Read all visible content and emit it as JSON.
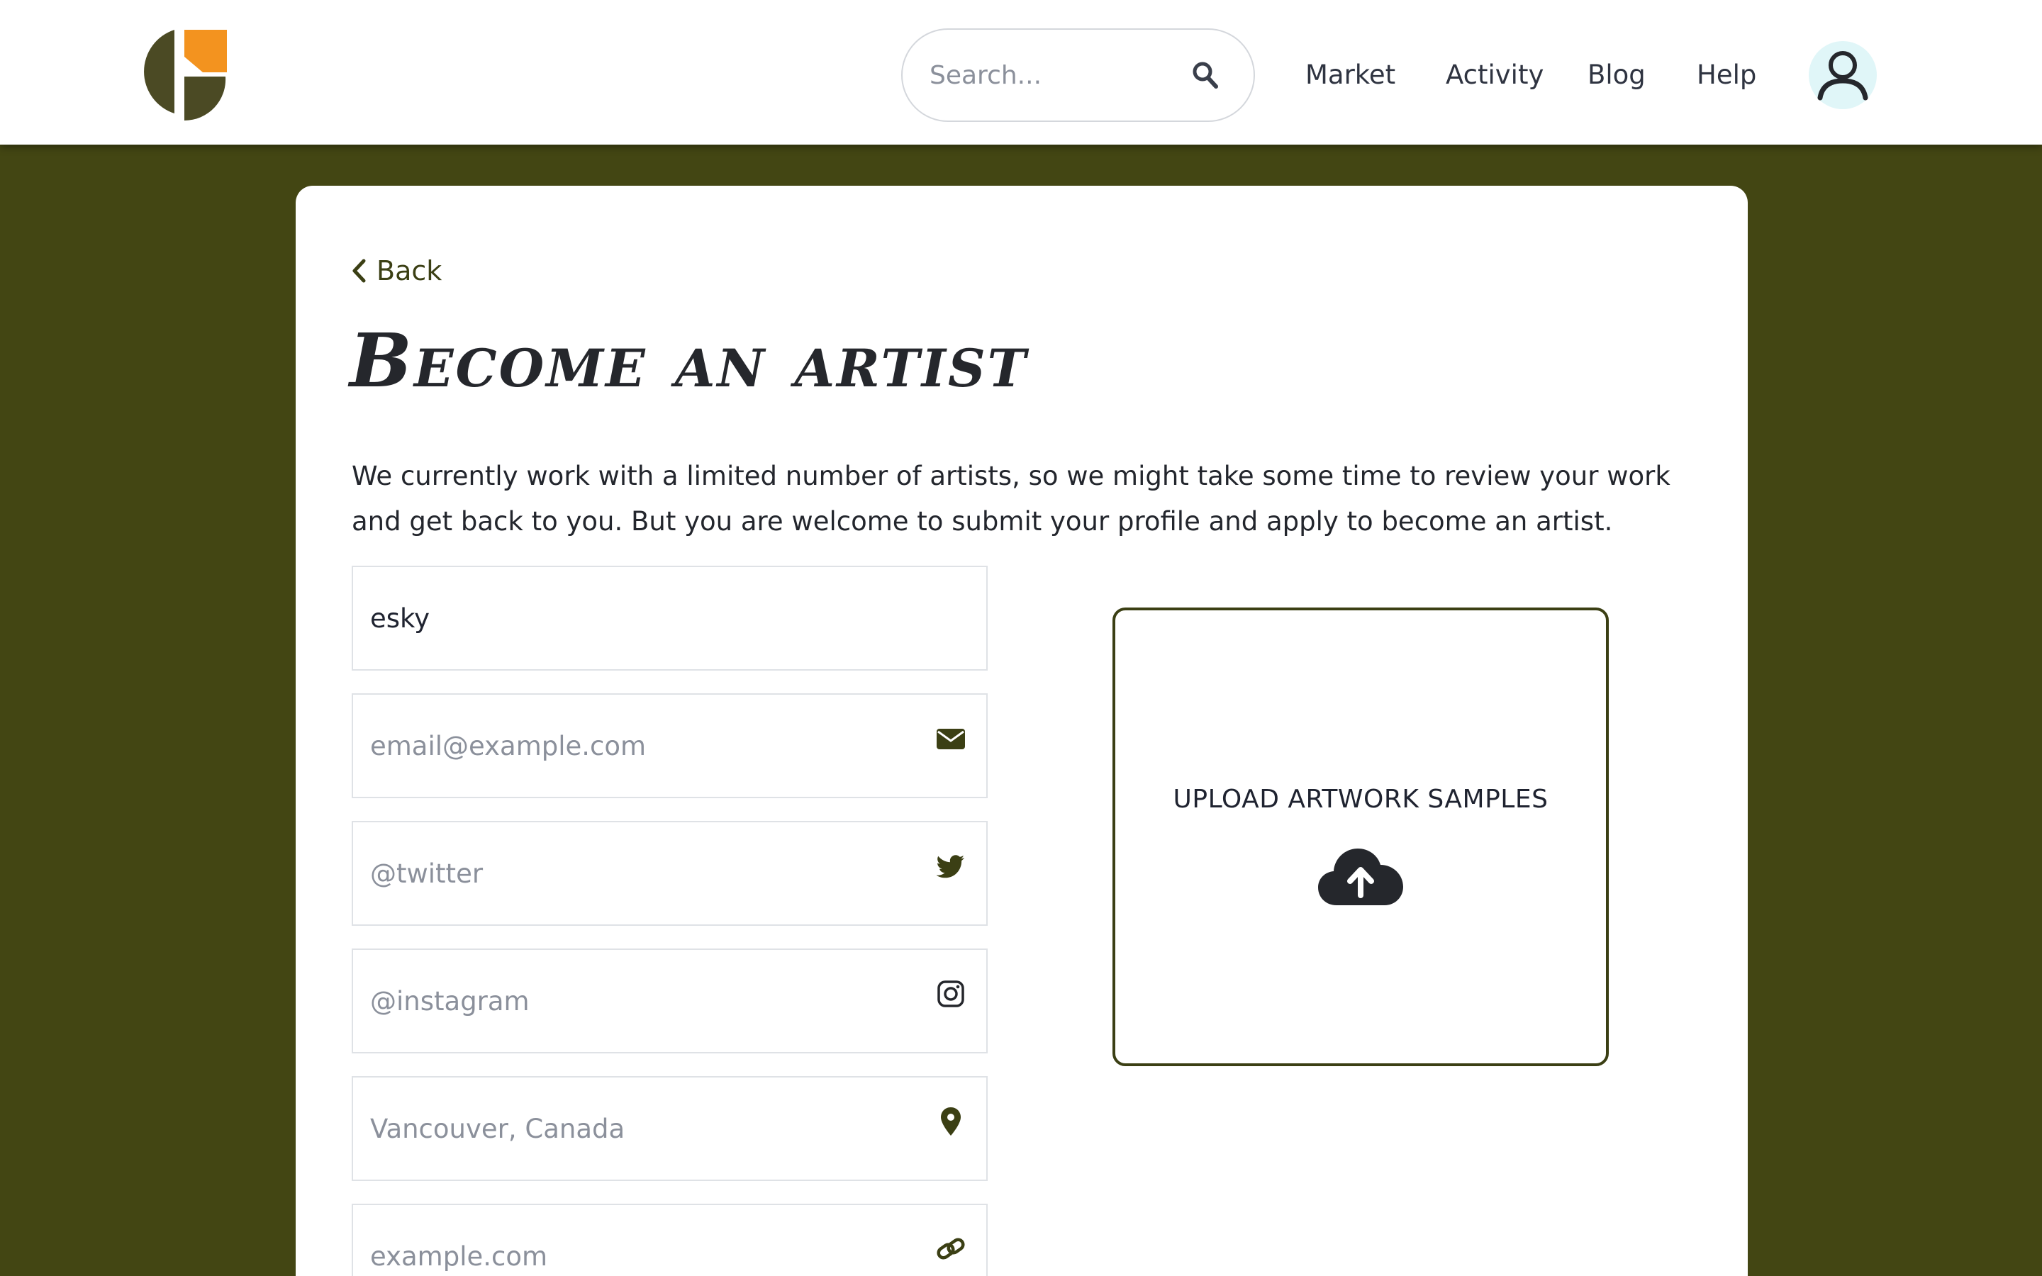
{
  "header": {
    "search_placeholder": "Search...",
    "nav": [
      "Market",
      "Activity",
      "Blog",
      "Help"
    ]
  },
  "colors": {
    "page_background": "#434613",
    "accent": "#3b3f14",
    "logo_dark": "#4b4a24",
    "logo_orange": "#f3931f",
    "avatar_background": "#e0f6f8"
  },
  "card": {
    "back_label": "Back",
    "title": "Become an artist",
    "intro": "We currently work with a limited number of artists, so we might take some time to review your work and get back to you. But you are welcome to submit your profile and apply to become an artist.",
    "fields": [
      {
        "name": "name",
        "value": "esky",
        "placeholder": "",
        "icon": ""
      },
      {
        "name": "email",
        "value": "",
        "placeholder": "email@example.com",
        "icon": "envelope-icon"
      },
      {
        "name": "twitter",
        "value": "",
        "placeholder": "@twitter",
        "icon": "twitter-icon"
      },
      {
        "name": "instagram",
        "value": "",
        "placeholder": "@instagram",
        "icon": "instagram-icon"
      },
      {
        "name": "location",
        "value": "",
        "placeholder": "Vancouver, Canada",
        "icon": "map-pin-icon"
      },
      {
        "name": "website",
        "value": "",
        "placeholder": "example.com",
        "icon": "link-icon"
      }
    ],
    "upload_label": "UPLOAD ARTWORK SAMPLES",
    "upload_icon": "cloud-upload-icon"
  }
}
